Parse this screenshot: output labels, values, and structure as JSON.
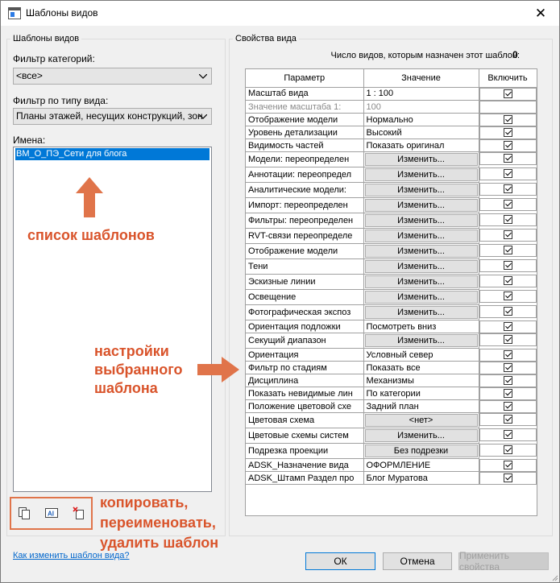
{
  "window": {
    "title": "Шаблоны видов",
    "close_glyph": "✕"
  },
  "left_panel": {
    "group_title": "Шаблоны видов",
    "category_filter_label": "Фильтр категорий:",
    "category_filter_value": "<все>",
    "view_type_filter_label": "Фильтр по типу вида:",
    "view_type_filter_value": "Планы этажей, несущих конструкций, зон",
    "names_label": "Имена:",
    "names": [
      "ВМ_О_ПЭ_Сети для блога"
    ]
  },
  "annotations": {
    "templates_list": "список шаблонов",
    "selected_settings": [
      "настройки",
      "выбранного",
      "шаблона"
    ],
    "buttons_hint": [
      "копировать,",
      "переименовать,",
      "удалить шаблон"
    ],
    "color": "#d9542b"
  },
  "toolbar": {
    "icons": [
      "duplicate-icon",
      "rename-icon",
      "delete-icon"
    ]
  },
  "right_panel": {
    "group_title": "Свойства вида",
    "assigned_count_label": "Число видов, которым назначен этот шаблон:",
    "assigned_count": "0",
    "columns": [
      "Параметр",
      "Значение",
      "Включить"
    ],
    "rows": [
      {
        "param": "Масштаб вида",
        "value": "1 : 100",
        "kind": "text",
        "checked": true
      },
      {
        "param": "Значение масштаба   1:",
        "value": "100",
        "kind": "text",
        "disabled": true,
        "checkbox": false
      },
      {
        "param": "Отображение модели",
        "value": "Нормально",
        "kind": "text",
        "checked": true
      },
      {
        "param": "Уровень детализации",
        "value": "Высокий",
        "kind": "text",
        "checked": true
      },
      {
        "param": "Видимость частей",
        "value": "Показать оригинал",
        "kind": "text",
        "checked": true
      },
      {
        "param": "Модели: переопределен",
        "value": "Изменить...",
        "kind": "button",
        "checked": true
      },
      {
        "param": "Аннотации: переопредел",
        "value": "Изменить...",
        "kind": "button",
        "checked": true
      },
      {
        "param": "Аналитические модели:",
        "value": "Изменить...",
        "kind": "button",
        "checked": true
      },
      {
        "param": "Импорт: переопределен",
        "value": "Изменить...",
        "kind": "button",
        "checked": true
      },
      {
        "param": "Фильтры: переопределен",
        "value": "Изменить...",
        "kind": "button",
        "checked": true
      },
      {
        "param": "RVT-связи переопределе",
        "value": "Изменить...",
        "kind": "button",
        "checked": true
      },
      {
        "param": "Отображение модели",
        "value": "Изменить...",
        "kind": "button",
        "checked": true
      },
      {
        "param": "Тени",
        "value": "Изменить...",
        "kind": "button",
        "checked": true
      },
      {
        "param": "Эскизные линии",
        "value": "Изменить...",
        "kind": "button",
        "checked": true
      },
      {
        "param": "Освещение",
        "value": "Изменить...",
        "kind": "button",
        "checked": true
      },
      {
        "param": "Фотографическая экспоз",
        "value": "Изменить...",
        "kind": "button",
        "checked": true
      },
      {
        "param": "Ориентация подложки",
        "value": "Посмотреть вниз",
        "kind": "text",
        "checked": true
      },
      {
        "param": "Секущий диапазон",
        "value": "Изменить...",
        "kind": "button",
        "checked": true
      },
      {
        "param": "Ориентация",
        "value": "Условный север",
        "kind": "text",
        "checked": true
      },
      {
        "param": "Фильтр по стадиям",
        "value": "Показать все",
        "kind": "text",
        "checked": true
      },
      {
        "param": "Дисциплина",
        "value": "Механизмы",
        "kind": "text",
        "checked": true
      },
      {
        "param": "Показать невидимые лин",
        "value": "По категории",
        "kind": "text",
        "checked": true
      },
      {
        "param": "Положение цветовой схе",
        "value": "Задний план",
        "kind": "text",
        "checked": true
      },
      {
        "param": "Цветовая схема",
        "value": "<нет>",
        "kind": "button",
        "checked": true
      },
      {
        "param": "Цветовые схемы систем",
        "value": "Изменить...",
        "kind": "button",
        "checked": true
      },
      {
        "param": "Подрезка проекции",
        "value": "Без подрезки",
        "kind": "button",
        "checked": true
      },
      {
        "param": "ADSK_Назначение вида",
        "value": "ОФОРМЛЕНИЕ",
        "kind": "text",
        "checked": true
      },
      {
        "param": "ADSK_Штамп Раздел про",
        "value": "Блог Муратова",
        "kind": "text",
        "checked": true
      }
    ]
  },
  "footer": {
    "help_link": "Как изменить шаблон вида?",
    "ok": "ОК",
    "cancel": "Отмена",
    "apply": "Применить свойства"
  }
}
